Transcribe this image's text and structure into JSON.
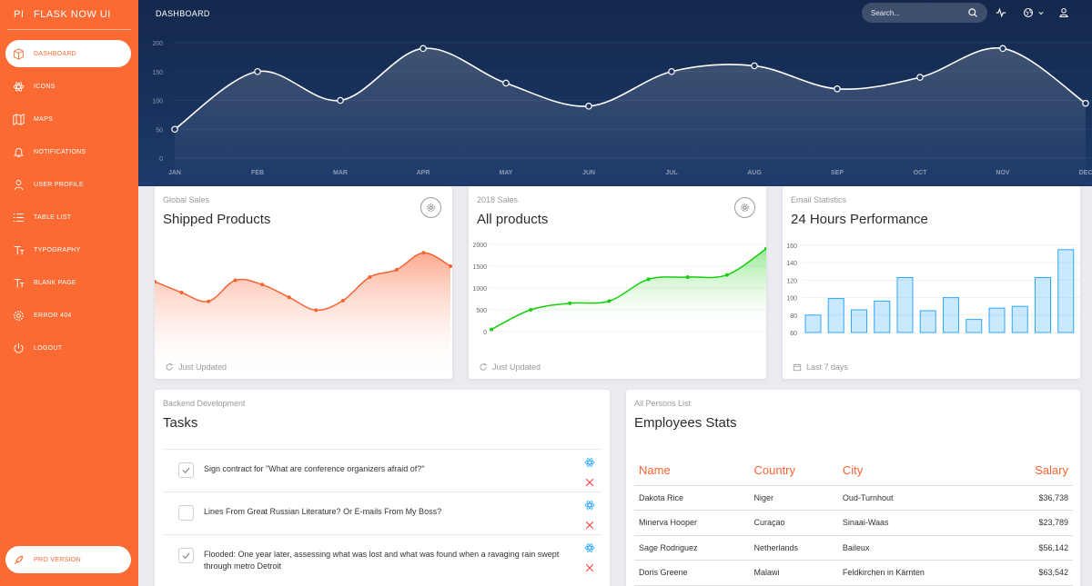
{
  "brand": {
    "mini": "PI",
    "name": "FLASK NOW UI"
  },
  "sidebar": {
    "items": [
      {
        "label": "DASHBOARD",
        "icon": "box-icon"
      },
      {
        "label": "ICONS",
        "icon": "atom-icon"
      },
      {
        "label": "MAPS",
        "icon": "map-icon"
      },
      {
        "label": "NOTIFICATIONS",
        "icon": "bell-icon"
      },
      {
        "label": "USER PROFILE",
        "icon": "user-icon"
      },
      {
        "label": "TABLE LIST",
        "icon": "list-icon"
      },
      {
        "label": "TYPOGRAPHY",
        "icon": "text-icon"
      },
      {
        "label": "BLANK PAGE",
        "icon": "text-icon"
      },
      {
        "label": "ERROR 404",
        "icon": "gear-icon"
      },
      {
        "label": "LOGOUT",
        "icon": "power-icon"
      }
    ],
    "pro": "PRO VERSION"
  },
  "header": {
    "breadcrumb": "DASHBOARD",
    "search_placeholder": "Search..."
  },
  "colors": {
    "accent": "#fa6a32",
    "header_dark": "#13284b",
    "green": "#18ce0f",
    "blue": "#2ca8ff"
  },
  "chart_data": [
    {
      "type": "line",
      "categories": [
        "JAN",
        "FEB",
        "MAR",
        "APR",
        "MAY",
        "JUN",
        "JUL",
        "AUG",
        "SEP",
        "OCT",
        "NOV",
        "DEC"
      ],
      "values": [
        50,
        150,
        100,
        190,
        130,
        90,
        150,
        160,
        120,
        140,
        190,
        95
      ],
      "yticks": [
        0,
        50,
        100,
        150,
        200
      ],
      "ylim": [
        0,
        200
      ]
    },
    {
      "type": "area",
      "category": "Global Sales",
      "title": "Shipped Products",
      "footer": "Just Updated",
      "values": [
        542,
        480,
        430,
        550,
        525,
        453,
        380,
        434,
        568,
        610,
        706,
        630
      ]
    },
    {
      "type": "area",
      "category": "2018 Sales",
      "title": "All products",
      "footer": "Just Updated",
      "values": [
        50,
        500,
        650,
        700,
        1200,
        1250,
        1300,
        1900
      ],
      "yticks": [
        0,
        500,
        1000,
        1500,
        2000
      ],
      "ylim": [
        0,
        2000
      ]
    },
    {
      "type": "bar",
      "category": "Email Statistics",
      "title": "24 Hours Performance",
      "footer": "Last 7 days",
      "values": [
        80,
        99,
        86,
        96,
        123,
        85,
        100,
        75,
        88,
        90,
        123,
        155
      ],
      "yticks": [
        60,
        80,
        100,
        120,
        140,
        160
      ],
      "ylim": [
        60,
        160
      ]
    }
  ],
  "tasks": {
    "category": "Backend Development",
    "title": "Tasks",
    "items": [
      {
        "text": "Sign contract for \"What are conference organizers afraid of?\"",
        "checked": true
      },
      {
        "text": "Lines From Great Russian Literature? Or E-mails From My Boss?",
        "checked": false
      },
      {
        "text": "Flooded: One year later, assessing what was lost and what was found when a ravaging rain swept through metro Detroit",
        "checked": true
      }
    ]
  },
  "employees": {
    "category": "All Persons List",
    "title": "Employees Stats",
    "columns": [
      "Name",
      "Country",
      "City",
      "Salary"
    ],
    "rows": [
      [
        "Dakota Rice",
        "Niger",
        "Oud-Turnhout",
        "$36,738"
      ],
      [
        "Minerva Hooper",
        "Curaçao",
        "Sinaai-Waas",
        "$23,789"
      ],
      [
        "Sage Rodriguez",
        "Netherlands",
        "Baileux",
        "$56,142"
      ],
      [
        "Doris Greene",
        "Malawi",
        "Feldkirchen in Kärnten",
        "$63,542"
      ]
    ]
  }
}
